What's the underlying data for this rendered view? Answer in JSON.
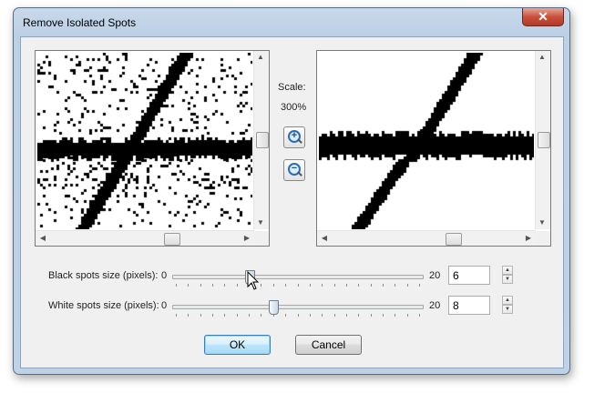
{
  "window": {
    "title": "Remove Isolated Spots",
    "close_symbol": "✕"
  },
  "scale": {
    "label": "Scale:",
    "value": "300%"
  },
  "zoom": {
    "in_symbol": "+",
    "out_symbol": "−"
  },
  "black_spots": {
    "label": "Black spots size (pixels):",
    "min": "0",
    "max": "20",
    "value": "6"
  },
  "white_spots": {
    "label": "White spots size (pixels):",
    "min": "0",
    "max": "20",
    "value": "8"
  },
  "buttons": {
    "ok": "OK",
    "cancel": "Cancel"
  },
  "scroll": {
    "up": "▲",
    "down": "▼",
    "left": "◀",
    "right": "▶"
  }
}
